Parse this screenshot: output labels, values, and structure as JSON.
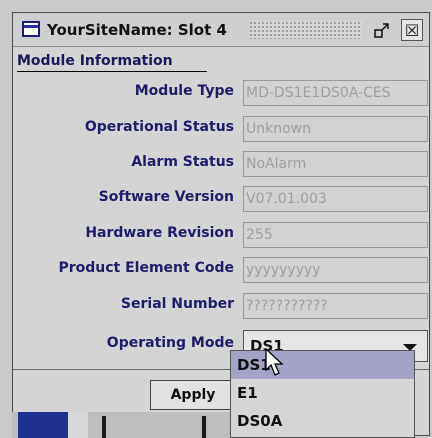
{
  "window": {
    "title": "YourSiteName: Slot 4",
    "restore_icon": "restore-icon",
    "close_label": "☒"
  },
  "section_header": "Module Information",
  "rows": [
    {
      "label": "Module Type",
      "value": "MD-DS1E1DS0A-CES"
    },
    {
      "label": "Operational Status",
      "value": "Unknown"
    },
    {
      "label": "Alarm Status",
      "value": "NoAlarm"
    },
    {
      "label": "Software Version",
      "value": "V07.01.003"
    },
    {
      "label": "Hardware Revision",
      "value": "255"
    },
    {
      "label": "Product Element Code",
      "value": "yyyyyyyyy"
    },
    {
      "label": "Serial Number",
      "value": "???????????"
    }
  ],
  "operating_mode": {
    "label": "Operating Mode",
    "selected": "DS1",
    "options": [
      "DS1",
      "E1",
      "DS0A"
    ]
  },
  "apply_label": "Apply",
  "colors": {
    "label_text": "#1d1d6a",
    "disabled_text": "#9e9e9e",
    "selected_option": "#a3a3c6",
    "taskbar_blue": "#1d2f8f"
  }
}
